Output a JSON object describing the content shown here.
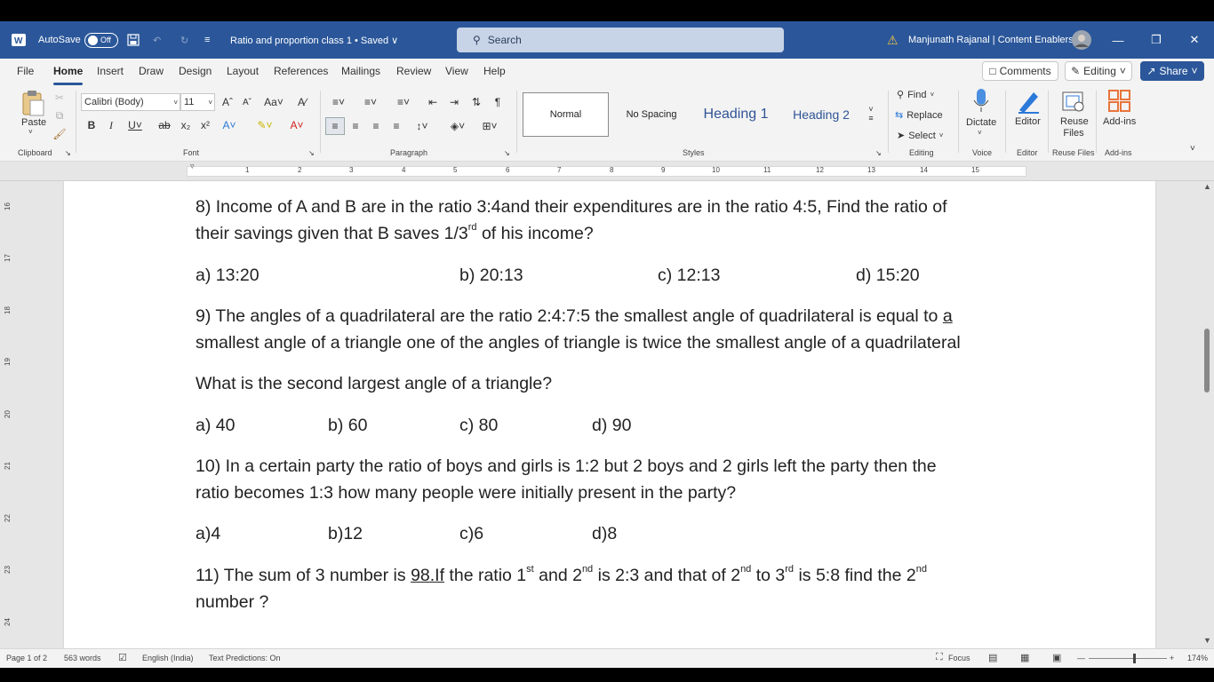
{
  "titlebar": {
    "autosave_label": "AutoSave",
    "autosave_state": "Off",
    "doc_title": "Ratio and proportion class 1 • Saved ∨",
    "search_placeholder": "Search",
    "user": "Manjunath Rajanal | Content Enablers"
  },
  "menu": {
    "tabs": [
      "File",
      "Home",
      "Insert",
      "Draw",
      "Design",
      "Layout",
      "References",
      "Mailings",
      "Review",
      "View",
      "Help"
    ],
    "active": "Home",
    "comments": "Comments",
    "editing": "Editing",
    "share": "Share"
  },
  "ribbon": {
    "paste": "Paste",
    "font_name": "Calibri (Body)",
    "font_size": "11",
    "styles": [
      "Normal",
      "No Spacing",
      "Heading 1",
      "Heading 2"
    ],
    "find": "Find",
    "replace": "Replace",
    "select": "Select",
    "dictate": "Dictate",
    "editor": "Editor",
    "reuse_files": "Reuse Files",
    "add_ins": "Add-ins",
    "groups": {
      "clipboard": "Clipboard",
      "font": "Font",
      "paragraph": "Paragraph",
      "styles": "Styles",
      "editing": "Editing",
      "voice": "Voice",
      "editor": "Editor",
      "reuse_files": "Reuse Files",
      "add_ins": "Add-ins"
    }
  },
  "ruler": {
    "numbers": [
      "1",
      "2",
      "3",
      "4",
      "5",
      "6",
      "7",
      "8",
      "9",
      "10",
      "11",
      "12",
      "13",
      "14",
      "15"
    ]
  },
  "vruler": {
    "numbers": [
      "16",
      "17",
      "18",
      "19",
      "20",
      "21",
      "22",
      "23",
      "24"
    ]
  },
  "document": {
    "q8_l1": "8) Income of A and B are in the ratio 3:4and their expenditures are in the ratio 4:5, Find the ratio of",
    "q8_l2a": "their savings given that B saves 1/3",
    "q8_l2sup": "rd",
    "q8_l2b": " of his income?",
    "q8_opts": [
      "a) 13:20",
      "b) 20:13",
      "c) 12:13",
      "d) 15:20"
    ],
    "q9_l1a": "9) The angles of a quadrilateral are the ratio 2:4:7:5 the smallest angle of quadrilateral is equal to ",
    "q9_l1b": "a",
    "q9_l2": "smallest angle of a triangle one of the angles of triangle is twice the smallest angle of a quadrilateral",
    "q9_l3": "What is the second largest angle of a triangle?",
    "q9_opts": [
      "a) 40",
      "b) 60",
      "c) 80",
      "d) 90"
    ],
    "q10_l1": "10) In a certain party the ratio of boys and girls is 1:2 but 2 boys and 2 girls left the party then the",
    "q10_l2": "ratio becomes 1:3 how many people were initially present in the party?",
    "q10_opts": [
      "a)4",
      "b)12",
      "c)6",
      "d)8"
    ],
    "q11_p1": "11) The sum of 3 number is ",
    "q11_p2": "98.If",
    "q11_p3": " the ratio 1",
    "q11_s1": "st",
    "q11_p4": " and 2",
    "q11_s2": "nd",
    "q11_p5": " is 2:3 and that of 2",
    "q11_s3": "nd",
    "q11_p6": " to 3",
    "q11_s4": "rd",
    "q11_p7": " is 5:8 find the 2",
    "q11_s5": "nd",
    "q11_l2": "number ?"
  },
  "status": {
    "page": "Page 1 of 2",
    "words": "563 words",
    "language": "English (India)",
    "predictions": "Text Predictions: On",
    "focus": "Focus",
    "zoom": "174%"
  },
  "colors": {
    "title_bg": "#2b579a",
    "ribbon_bg": "#f3f3f3",
    "canvas_bg": "#e6e6e6",
    "heading_blue": "#2f5496"
  }
}
